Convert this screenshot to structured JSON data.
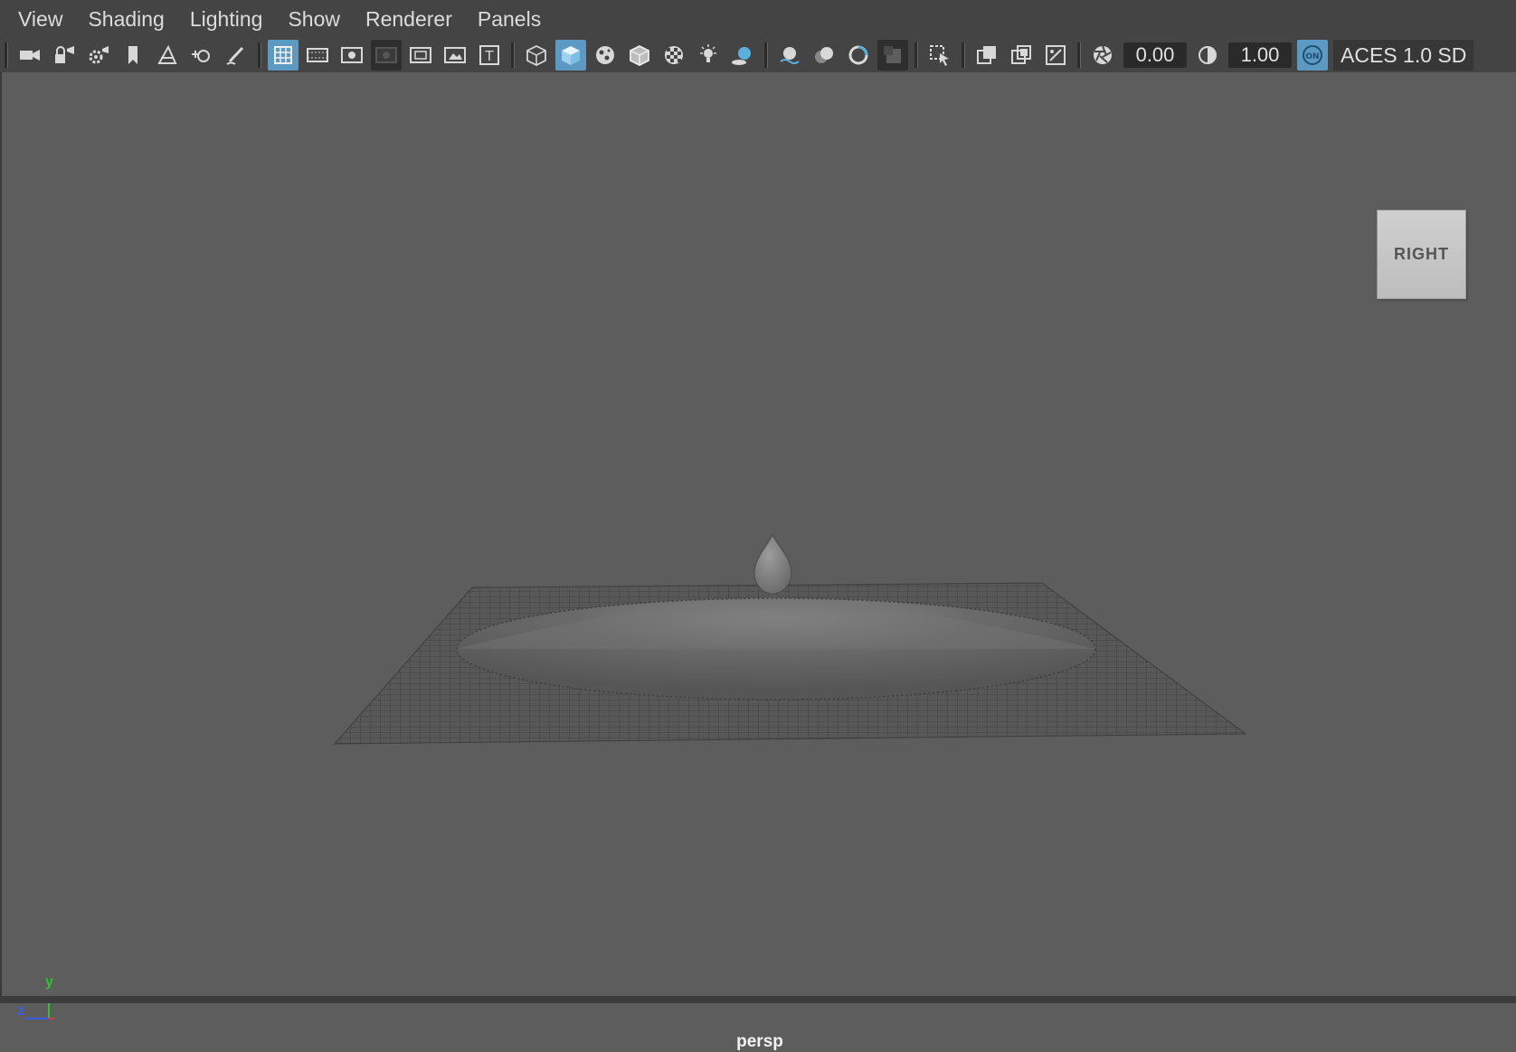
{
  "menu": {
    "items": [
      "View",
      "Shading",
      "Lighting",
      "Show",
      "Renderer",
      "Panels"
    ]
  },
  "toolbar": {
    "exposure_value": "0.00",
    "gamma_value": "1.00",
    "color_management_badge": "ON",
    "color_space_label": "ACES 1.0 SD",
    "icons": [
      "select-camera-icon",
      "lock-camera-icon",
      "camera-attributes-icon",
      "bookmark-icon",
      "image-plane-icon",
      "two-d-pan-zoom-icon",
      "grease-pencil-icon",
      "grid-icon",
      "film-gate-icon",
      "resolution-gate-icon",
      "gate-mask-icon",
      "field-chart-icon",
      "safe-action-icon",
      "safe-title-icon",
      "wireframe-icon",
      "smooth-shade-all-icon",
      "use-default-material-icon",
      "wireframe-on-shaded-icon",
      "textured-icon",
      "use-all-lights-icon",
      "shadows-icon",
      "screen-space-ambient-occlusion-icon",
      "motion-blur-icon",
      "multisample-anti-aliasing-icon",
      "depth-of-field-icon",
      "isolate-select-icon",
      "xray-icon",
      "xray-joints-icon",
      "xray-active-components-icon",
      "exposure-icon",
      "gamma-icon",
      "color-management-icon"
    ]
  },
  "viewport": {
    "camera_name": "persp",
    "view_cube_label": "RIGHT",
    "axis_labels": {
      "y": "y",
      "z": "z"
    },
    "colors": {
      "background": "#5d5d5d",
      "active_button": "#5c9ac4",
      "axis_x": "#e23a3a",
      "axis_y": "#28c828",
      "axis_z": "#3a5ae8"
    }
  }
}
